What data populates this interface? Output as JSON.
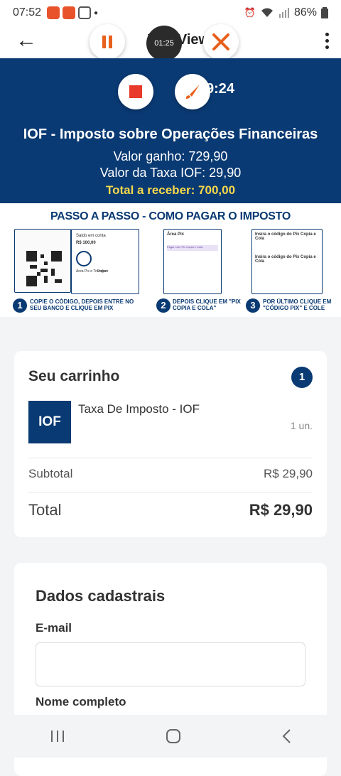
{
  "status": {
    "time": "07:52",
    "battery": "86%"
  },
  "appbar": {
    "title": "WebView"
  },
  "recorder": {
    "timer": "01:25"
  },
  "banner": {
    "clock": "9:24",
    "title": "IOF - Imposto sobre Operações Financeiras",
    "valor_ganho": "Valor ganho: 729,90",
    "valor_taxa": "Valor da Taxa IOF: 29,90",
    "total_label": "Total a receber:",
    "total_value": "700,00"
  },
  "steps": {
    "title": "PASSO A PASSO - COMO PAGAR O IMPOSTO",
    "items": [
      {
        "num": "1",
        "caption": "COPIE O CÓDIGO, DEPOIS ENTRE NO SEU BANCO E CLIQUE EM PIX"
      },
      {
        "num": "2",
        "caption": "DEPOIS CLIQUE EM \"PIX COPIA E COLA\""
      },
      {
        "num": "3",
        "caption": "POR ÚLTIMO CLIQUE EM \"CÓDIGO PIX\" E COLE"
      }
    ],
    "shot1": {
      "saldo": "Saldo em conta",
      "valor": "R$ 100,00",
      "area_pix": "Área Pix e Transferir",
      "pagar": "Pagar"
    },
    "shot2": {
      "title": "Área Pix",
      "copia_cola": "Pagar com Pix Copia e Cola"
    },
    "shot3": {
      "label1": "Insira o código do Pix Copia e Cola",
      "label2": "Insira o código do Pix Copia e Cola"
    }
  },
  "cart": {
    "title": "Seu carrinho",
    "count": "1",
    "thumb": "IOF",
    "product": "Taxa De Imposto - IOF",
    "qty": "1 un.",
    "subtotal_label": "Subtotal",
    "subtotal_value": "R$ 29,90",
    "total_label": "Total",
    "total_value": "R$ 29,90"
  },
  "form": {
    "title": "Dados cadastrais",
    "email_label": "E-mail",
    "email_value": "",
    "name_label": "Nome completo"
  },
  "colors": {
    "brand": "#0a3a73",
    "highlight": "#f6d84a",
    "record": "#e8392b",
    "pause": "#e8601c"
  }
}
